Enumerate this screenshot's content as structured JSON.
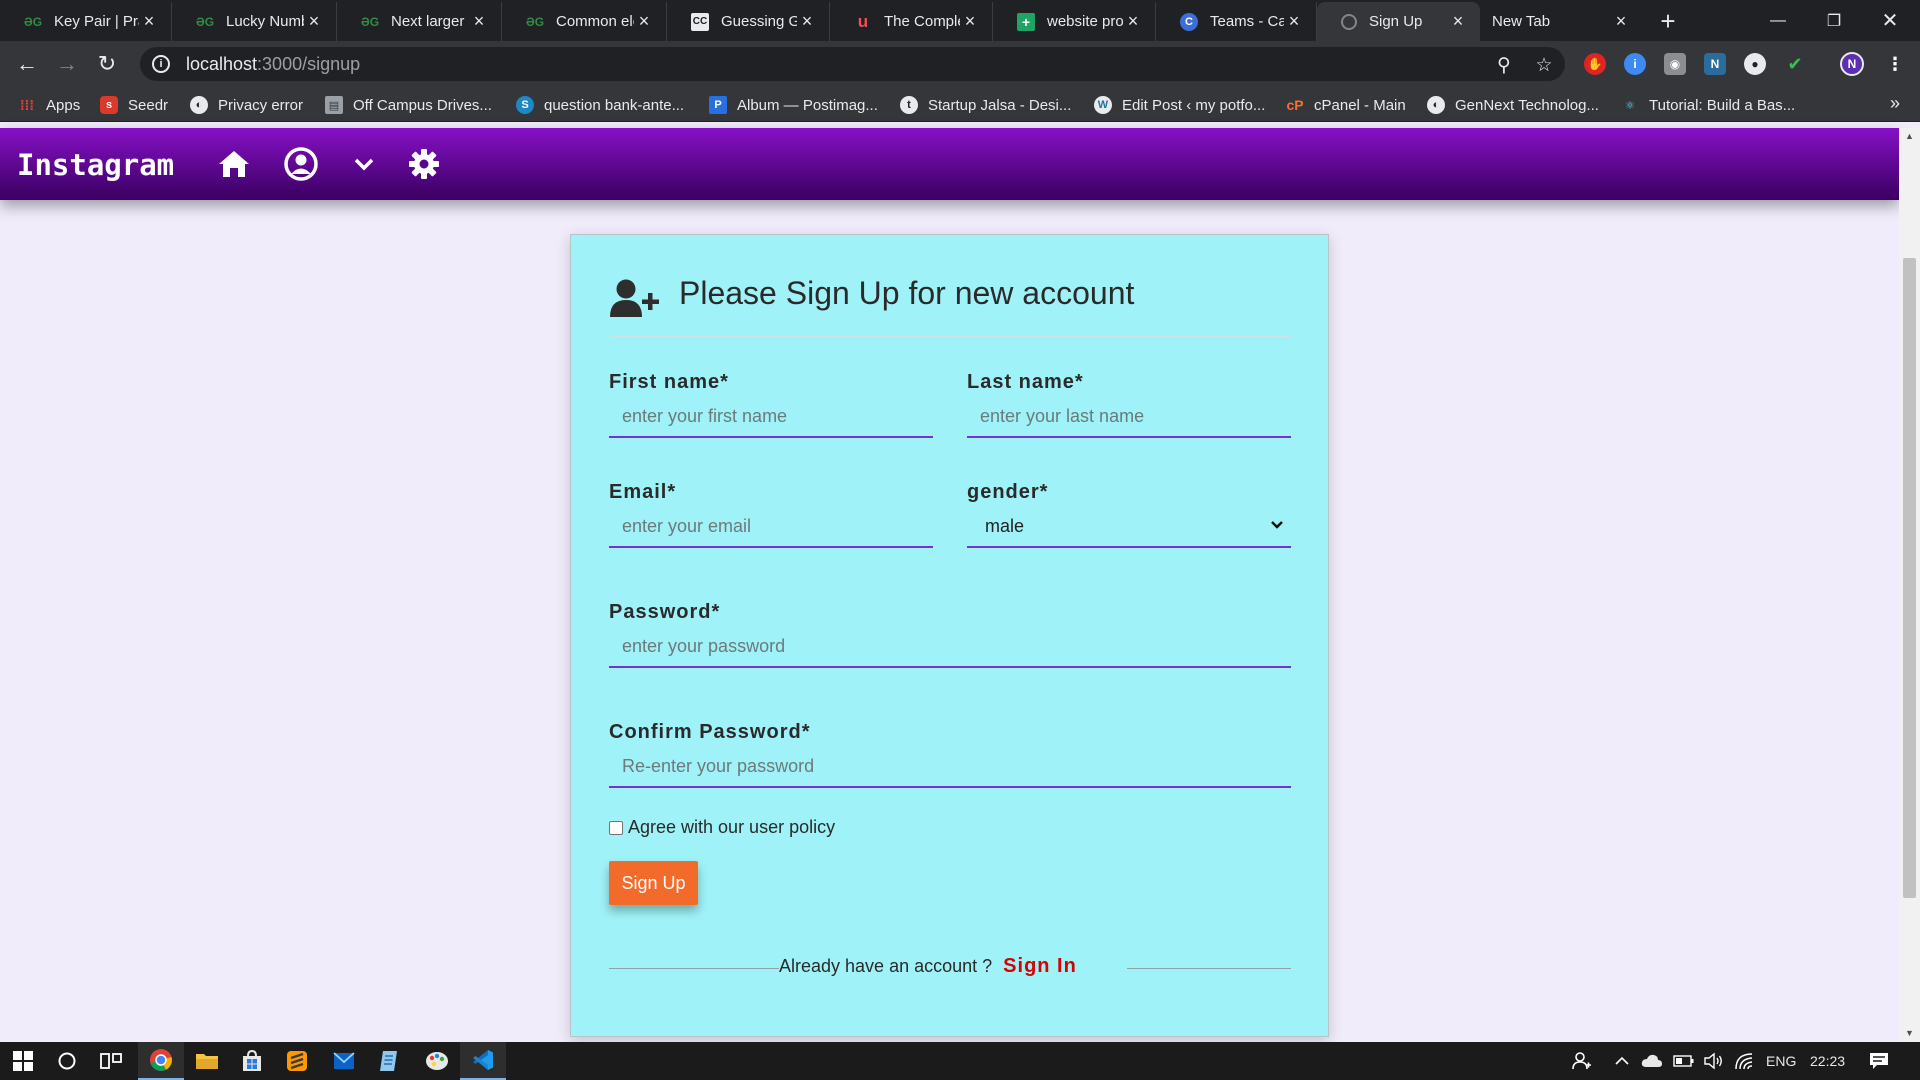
{
  "browser": {
    "tabs": [
      {
        "title": "Key Pair | Pra",
        "favicon": "gfg-icon"
      },
      {
        "title": "Lucky Numb",
        "favicon": "gfg-icon"
      },
      {
        "title": "Next larger e",
        "favicon": "gfg-icon"
      },
      {
        "title": "Common ele",
        "favicon": "gfg-icon"
      },
      {
        "title": "Guessing Ga",
        "favicon": "cc-icon"
      },
      {
        "title": "The Comple",
        "favicon": "udemy-icon"
      },
      {
        "title": "website prof",
        "favicon": "sheets-icon"
      },
      {
        "title": "Teams - Can",
        "favicon": "c-icon"
      },
      {
        "title": "Sign Up",
        "favicon": "globe-icon",
        "active": true
      },
      {
        "title": "New Tab",
        "favicon": ""
      }
    ],
    "url": {
      "host": "localhost",
      "path": ":3000/signup"
    },
    "bookmarks": [
      {
        "label": "Apps",
        "icon": "apps-grid-icon"
      },
      {
        "label": "Seedr",
        "icon": "seedr-icon"
      },
      {
        "label": "Privacy error",
        "icon": "globe-icon"
      },
      {
        "label": "Off Campus Drives...",
        "icon": "page-icon"
      },
      {
        "label": "question bank-ante...",
        "icon": "s-icon"
      },
      {
        "label": "Album — Postimag...",
        "icon": "postimage-icon"
      },
      {
        "label": "Startup Jalsa - Desi...",
        "icon": "startup-icon"
      },
      {
        "label": "Edit Post ‹ my potfo...",
        "icon": "wordpress-icon"
      },
      {
        "label": "cPanel - Main",
        "icon": "cpanel-icon"
      },
      {
        "label": "GenNext Technolog...",
        "icon": "globe-icon"
      },
      {
        "label": "Tutorial: Build a Bas...",
        "icon": "react-icon"
      }
    ],
    "more_bookmarks": "»"
  },
  "app": {
    "brand": "Instagram",
    "nav_icons": [
      "home-icon",
      "account-icon",
      "chevron-down-icon",
      "settings-icon"
    ]
  },
  "signup": {
    "title": "Please Sign Up for new account",
    "first_name": {
      "label": "First name*",
      "placeholder": "enter your first name"
    },
    "last_name": {
      "label": "Last name*",
      "placeholder": "enter your last name"
    },
    "email": {
      "label": "Email*",
      "placeholder": "enter your email"
    },
    "gender": {
      "label": "gender*",
      "value": "male"
    },
    "password": {
      "label": "Password*",
      "placeholder": "enter your password"
    },
    "confirm_password": {
      "label": "Confirm Password*",
      "placeholder": "Re-enter your password"
    },
    "agree_label": "Agree with our user policy",
    "submit_label": "Sign Up",
    "already_text": "Already have an account ?",
    "signin_label": "Sign In"
  },
  "taskbar": {
    "language": "ENG",
    "time": "22:23"
  },
  "colors": {
    "navbar_top": "#8610c6",
    "navbar_bottom": "#3a0060",
    "card_bg": "#9ff3f8",
    "page_bg": "#f0ecfa",
    "input_underline": "#7a2fd0",
    "button_bg": "#f26b2b",
    "signin_link": "#d80000"
  }
}
